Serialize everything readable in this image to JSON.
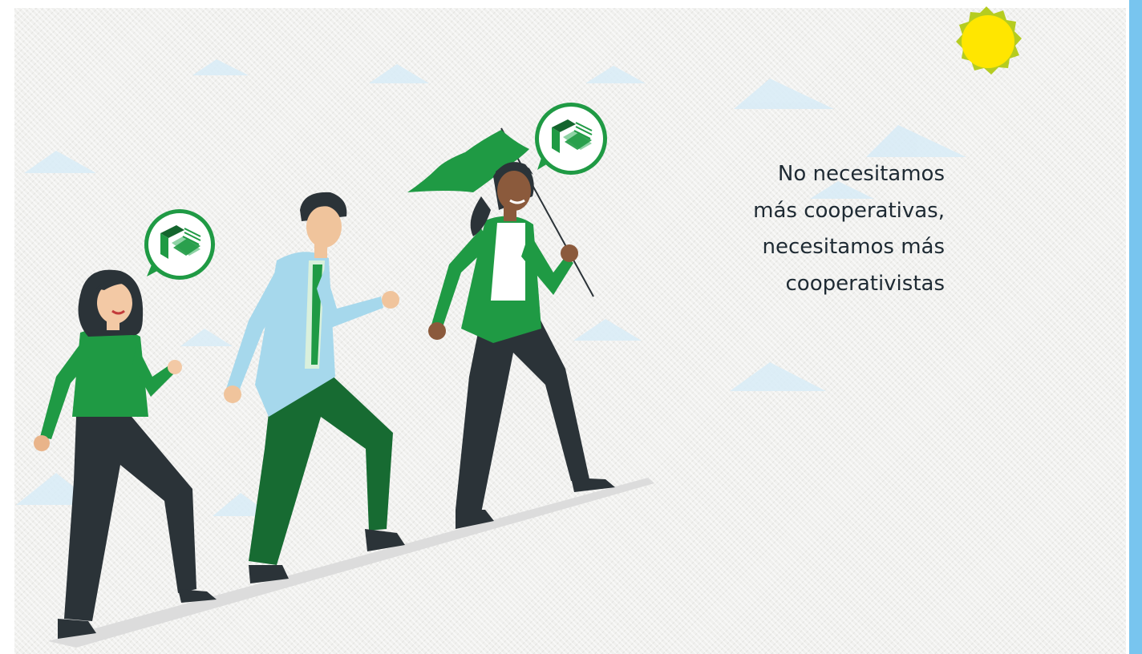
{
  "quote": {
    "lines": [
      "No necesitamos",
      "más cooperativas,",
      "necesitamos más",
      "cooperativistas"
    ]
  },
  "colors": {
    "background": "#f0f0ee",
    "accent_bar": "#78c5ef",
    "brand_green": "#1f9a44",
    "dark_green": "#14652d",
    "sky_blue_jacket": "#a6d8ec",
    "pants_dark": "#2b3338",
    "sun": "#ffe600",
    "cloud": "#d8ecf7"
  },
  "icons": [
    "sun-icon",
    "cooperative-logo-icon",
    "flag-icon",
    "cloud-icon"
  ]
}
